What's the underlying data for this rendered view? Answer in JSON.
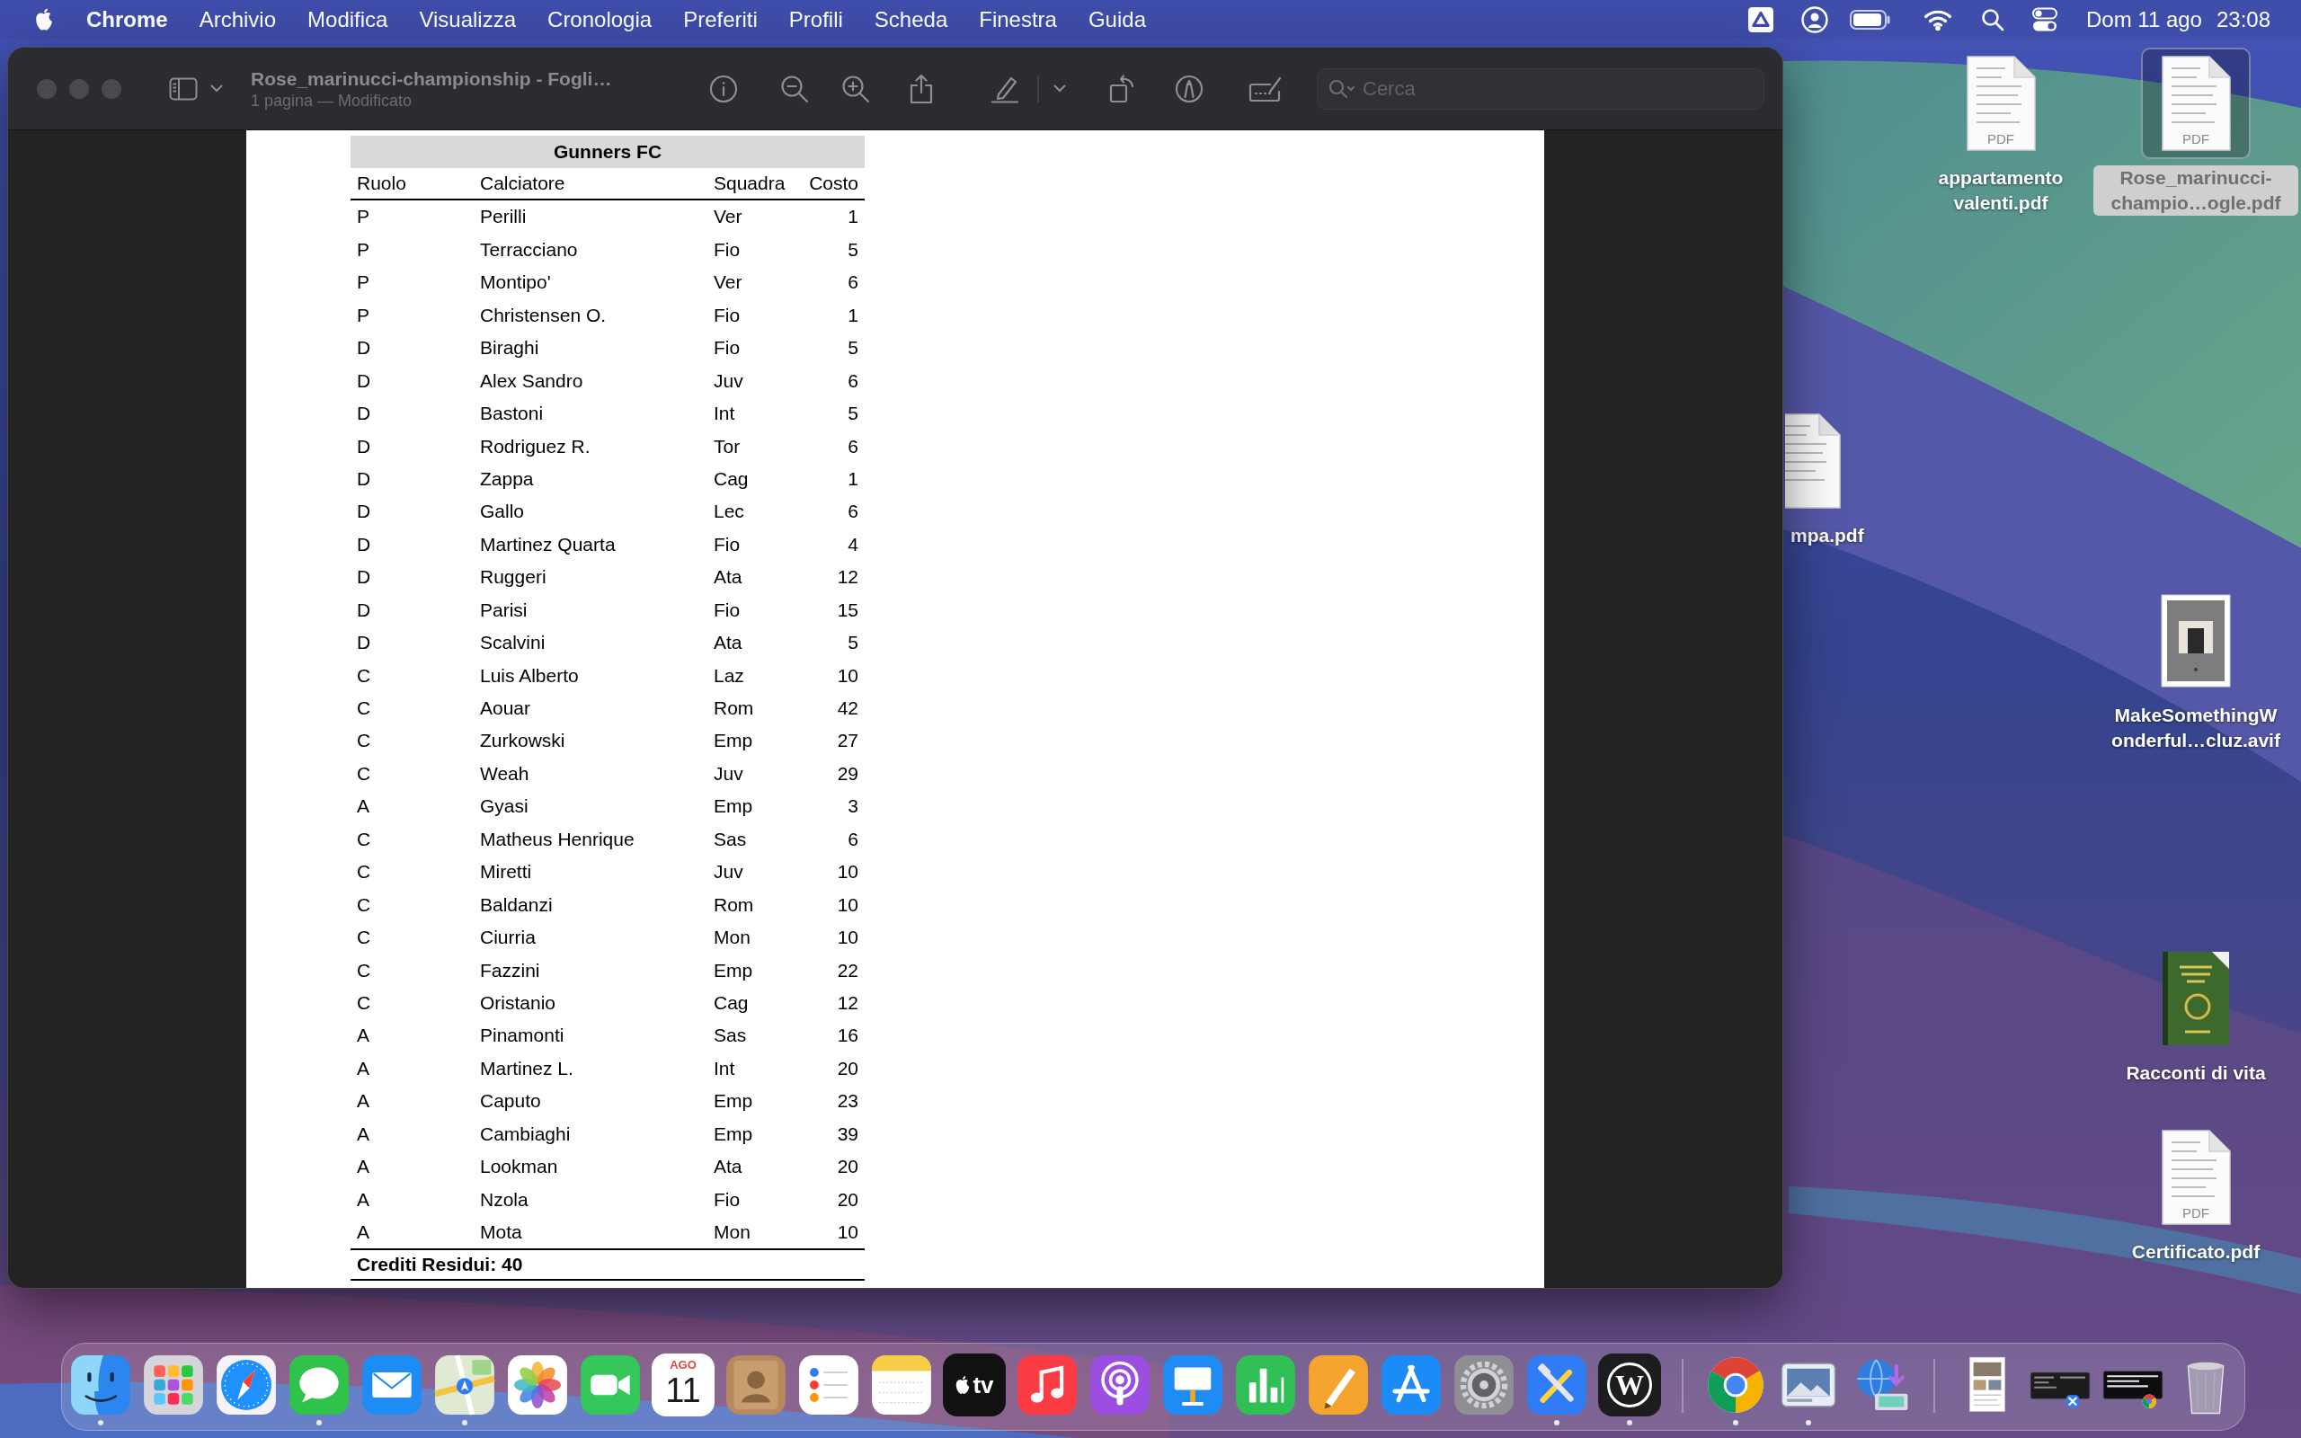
{
  "menu_bar": {
    "app": "Chrome",
    "menus": [
      "Archivio",
      "Modifica",
      "Visualizza",
      "Cronologia",
      "Preferiti",
      "Profili",
      "Scheda",
      "Finestra",
      "Guida"
    ],
    "date": "Dom 11 ago",
    "time": "23:08"
  },
  "window": {
    "title": "Rose_marinucci-championship - Fogli…",
    "subtitle": "1 pagina — Modificato",
    "search": {
      "placeholder": "Cerca"
    },
    "document": {
      "table": {
        "title": "Gunners FC",
        "columns": [
          "Ruolo",
          "Calciatore",
          "Squadra",
          "Costo"
        ],
        "rows": [
          [
            "P",
            "Perilli",
            "Ver",
            "1"
          ],
          [
            "P",
            "Terracciano",
            "Fio",
            "5"
          ],
          [
            "P",
            "Montipo'",
            "Ver",
            "6"
          ],
          [
            "P",
            "Christensen O.",
            "Fio",
            "1"
          ],
          [
            "D",
            "Biraghi",
            "Fio",
            "5"
          ],
          [
            "D",
            "Alex Sandro",
            "Juv",
            "6"
          ],
          [
            "D",
            "Bastoni",
            "Int",
            "5"
          ],
          [
            "D",
            "Rodriguez R.",
            "Tor",
            "6"
          ],
          [
            "D",
            "Zappa",
            "Cag",
            "1"
          ],
          [
            "D",
            "Gallo",
            "Lec",
            "6"
          ],
          [
            "D",
            "Martinez Quarta",
            "Fio",
            "4"
          ],
          [
            "D",
            "Ruggeri",
            "Ata",
            "12"
          ],
          [
            "D",
            "Parisi",
            "Fio",
            "15"
          ],
          [
            "D",
            "Scalvini",
            "Ata",
            "5"
          ],
          [
            "C",
            "Luis Alberto",
            "Laz",
            "10"
          ],
          [
            "C",
            "Aouar",
            "Rom",
            "42"
          ],
          [
            "C",
            "Zurkowski",
            "Emp",
            "27"
          ],
          [
            "C",
            "Weah",
            "Juv",
            "29"
          ],
          [
            "A",
            "Gyasi",
            "Emp",
            "3"
          ],
          [
            "C",
            "Matheus Henrique",
            "Sas",
            "6"
          ],
          [
            "C",
            "Miretti",
            "Juv",
            "10"
          ],
          [
            "C",
            "Baldanzi",
            "Rom",
            "10"
          ],
          [
            "C",
            "Ciurria",
            "Mon",
            "10"
          ],
          [
            "C",
            "Fazzini",
            "Emp",
            "22"
          ],
          [
            "C",
            "Oristanio",
            "Cag",
            "12"
          ],
          [
            "A",
            "Pinamonti",
            "Sas",
            "16"
          ],
          [
            "A",
            "Martinez L.",
            "Int",
            "20"
          ],
          [
            "A",
            "Caputo",
            "Emp",
            "23"
          ],
          [
            "A",
            "Cambiaghi",
            "Emp",
            "39"
          ],
          [
            "A",
            "Lookman",
            "Ata",
            "20"
          ],
          [
            "A",
            "Nzola",
            "Fio",
            "20"
          ],
          [
            "A",
            "Mota",
            "Mon",
            "10"
          ]
        ],
        "footer": "Crediti Residui: 40"
      }
    }
  },
  "desktop_icons": [
    {
      "kind": "document",
      "label": "appartamento valenti.pdf",
      "badge": "PDF",
      "selected": false
    },
    {
      "kind": "document",
      "label": "Rose_marinucci-champio…ogle.pdf",
      "badge": "PDF",
      "selected": true
    },
    {
      "kind": "document",
      "label": "mpa.pdf",
      "selected": false
    },
    {
      "kind": "image",
      "label": "MakeSomethingWonderful…cluz.avif",
      "selected": false
    },
    {
      "kind": "book",
      "label": "Racconti di vita",
      "selected": false
    },
    {
      "kind": "document",
      "label": "Certificato.pdf",
      "badge": "PDF",
      "selected": false
    }
  ],
  "dock": {
    "apps": [
      {
        "kind": "finder",
        "running": true
      },
      {
        "kind": "launchpad",
        "running": false
      },
      {
        "kind": "safari",
        "running": false
      },
      {
        "kind": "messages",
        "running": true
      },
      {
        "kind": "mail",
        "running": false
      },
      {
        "kind": "maps",
        "running": true
      },
      {
        "kind": "photos",
        "running": false
      },
      {
        "kind": "facetime",
        "running": false
      },
      {
        "kind": "calendar",
        "running": false,
        "month": "AGO",
        "day": "11"
      },
      {
        "kind": "contacts",
        "running": false
      },
      {
        "kind": "reminders",
        "running": false
      },
      {
        "kind": "notes",
        "running": false
      },
      {
        "kind": "tv",
        "running": false,
        "label": "tv"
      },
      {
        "kind": "music",
        "running": false
      },
      {
        "kind": "podcasts",
        "running": false
      },
      {
        "kind": "keynote",
        "running": false
      },
      {
        "kind": "numbers",
        "running": false
      },
      {
        "kind": "pages",
        "running": false
      },
      {
        "kind": "appstore",
        "running": false
      },
      {
        "kind": "settings",
        "running": false
      },
      {
        "kind": "tools",
        "running": true
      },
      {
        "kind": "wordpress",
        "running": true,
        "label": "W"
      }
    ],
    "recent": [
      {
        "kind": "chrome",
        "running": true
      },
      {
        "kind": "preview",
        "running": true
      },
      {
        "kind": "network",
        "running": false
      }
    ],
    "stack": [
      {
        "kind": "page"
      },
      {
        "kind": "window"
      },
      {
        "kind": "webwindow"
      },
      {
        "kind": "trash"
      }
    ]
  }
}
